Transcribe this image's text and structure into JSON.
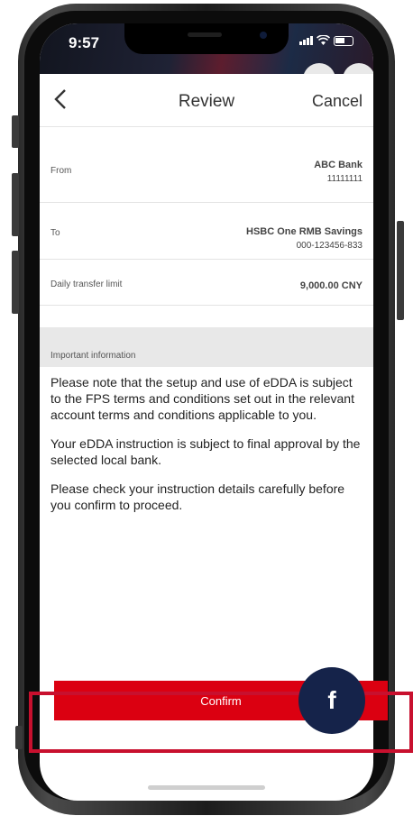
{
  "status_bar": {
    "time": "9:57"
  },
  "nav": {
    "title": "Review",
    "cancel_label": "Cancel"
  },
  "details": {
    "from_label": "From",
    "from_bank": "ABC Bank",
    "from_account": "11111111",
    "to_label": "To",
    "to_bank": "HSBC One RMB Savings",
    "to_account": "000-123456-833",
    "limit_label": "Daily transfer limit",
    "limit_value": "9,000.00 CNY"
  },
  "info": {
    "header": "Important information",
    "paragraphs": [
      "Please note that the setup and use of eDDA is subject to the FPS terms and conditions set out in the relevant account terms and conditions applicable to you.",
      "Your eDDA instruction is subject to final approval by the selected local bank.",
      "Please check your instruction details carefully before you confirm to proceed."
    ]
  },
  "confirm_label": "Confirm",
  "step_badge": "f",
  "colors": {
    "primary_red": "#db0011",
    "badge_navy": "#15234a",
    "highlight_red": "#c8102e"
  }
}
